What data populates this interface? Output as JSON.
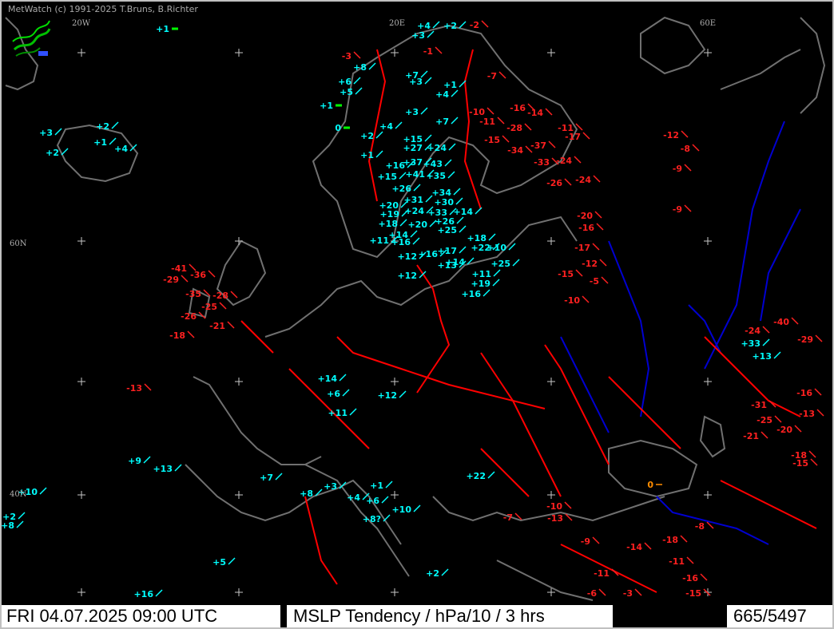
{
  "app": {
    "credit": "MetWatch  (c) 1991-2025 T.Bruns, B.Richter"
  },
  "map": {
    "meridian_labels": [
      "20W",
      "20E",
      "60E"
    ],
    "parallel_labels": [
      "60N",
      "40N"
    ],
    "colors": {
      "background": "#000000",
      "coast": "#707070",
      "borders": "#ff0000",
      "rivers": "#0000d0",
      "rising": "#00ffff",
      "falling": "#ff2020",
      "steady": "#00ff00",
      "zero": "#ff8c00"
    },
    "observations": [
      {
        "v": "+1",
        "t": "s"
      },
      {
        "v": "+4",
        "t": "r"
      },
      {
        "v": "+2",
        "t": "r"
      },
      {
        "v": "+3",
        "t": "r"
      },
      {
        "v": "+6",
        "t": "r"
      },
      {
        "v": "+8",
        "t": "r"
      },
      {
        "v": "+5",
        "t": "r"
      },
      {
        "v": "+7",
        "t": "r"
      },
      {
        "v": "+3",
        "t": "r"
      },
      {
        "v": "+1",
        "t": "r"
      },
      {
        "v": "+4",
        "t": "r"
      },
      {
        "v": "+1",
        "t": "s"
      },
      {
        "v": "+3",
        "t": "r"
      },
      {
        "v": "+7",
        "t": "r"
      },
      {
        "v": "0",
        "t": "s"
      },
      {
        "v": "+2",
        "t": "r"
      },
      {
        "v": "+4",
        "t": "r"
      },
      {
        "v": "+1",
        "t": "r"
      },
      {
        "v": "+15",
        "t": "r"
      },
      {
        "v": "+27",
        "t": "r"
      },
      {
        "v": "+24",
        "t": "r"
      },
      {
        "v": "+16",
        "t": "r"
      },
      {
        "v": "+37",
        "t": "r"
      },
      {
        "v": "+43",
        "t": "r"
      },
      {
        "v": "+15",
        "t": "r"
      },
      {
        "v": "+41",
        "t": "r"
      },
      {
        "v": "+35",
        "t": "r"
      },
      {
        "v": "+26",
        "t": "r"
      },
      {
        "v": "+31",
        "t": "r"
      },
      {
        "v": "+34",
        "t": "r"
      },
      {
        "v": "+20",
        "t": "r"
      },
      {
        "v": "+24",
        "t": "r"
      },
      {
        "v": "+30",
        "t": "r"
      },
      {
        "v": "+19",
        "t": "r"
      },
      {
        "v": "+33",
        "t": "r"
      },
      {
        "v": "+14",
        "t": "r"
      },
      {
        "v": "+18",
        "t": "r"
      },
      {
        "v": "+26",
        "t": "r"
      },
      {
        "v": "+20",
        "t": "r"
      },
      {
        "v": "+25",
        "t": "r"
      },
      {
        "v": "+14",
        "t": "r"
      },
      {
        "v": "+18",
        "t": "r"
      },
      {
        "v": "+11",
        "t": "r"
      },
      {
        "v": "+16",
        "t": "r"
      },
      {
        "v": "+17",
        "t": "r"
      },
      {
        "v": "+22",
        "t": "r"
      },
      {
        "v": "+10",
        "t": "r"
      },
      {
        "v": "+12",
        "t": "r"
      },
      {
        "v": "+16",
        "t": "r"
      },
      {
        "v": "+13",
        "t": "r"
      },
      {
        "v": "+25",
        "t": "r"
      },
      {
        "v": "+12",
        "t": "r"
      },
      {
        "v": "+14",
        "t": "r"
      },
      {
        "v": "+19",
        "t": "r"
      },
      {
        "v": "+11",
        "t": "r"
      },
      {
        "v": "+16",
        "t": "r"
      },
      {
        "v": "+3",
        "t": "r"
      },
      {
        "v": "+2",
        "t": "r"
      },
      {
        "v": "+1",
        "t": "r"
      },
      {
        "v": "+2",
        "t": "r"
      },
      {
        "v": "+4",
        "t": "r"
      },
      {
        "v": "-3",
        "t": "f"
      },
      {
        "v": "-2",
        "t": "f"
      },
      {
        "v": "-1",
        "t": "f"
      },
      {
        "v": "-7",
        "t": "f"
      },
      {
        "v": "-16",
        "t": "f"
      },
      {
        "v": "-14",
        "t": "f"
      },
      {
        "v": "-28",
        "t": "f"
      },
      {
        "v": "-15",
        "t": "f"
      },
      {
        "v": "-34",
        "t": "f"
      },
      {
        "v": "-37",
        "t": "f"
      },
      {
        "v": "-33",
        "t": "f"
      },
      {
        "v": "-24",
        "t": "f"
      },
      {
        "v": "-11",
        "t": "f"
      },
      {
        "v": "-17",
        "t": "f"
      },
      {
        "v": "-10",
        "t": "f"
      },
      {
        "v": "-11",
        "t": "f"
      },
      {
        "v": "-12",
        "t": "f"
      },
      {
        "v": "-8",
        "t": "f"
      },
      {
        "v": "-9",
        "t": "f"
      },
      {
        "v": "-26",
        "t": "f"
      },
      {
        "v": "-24",
        "t": "f"
      },
      {
        "v": "-20",
        "t": "f"
      },
      {
        "v": "-16",
        "t": "f"
      },
      {
        "v": "-17",
        "t": "f"
      },
      {
        "v": "-15",
        "t": "f"
      },
      {
        "v": "-10",
        "t": "f"
      },
      {
        "v": "-12",
        "t": "f"
      },
      {
        "v": "-5",
        "t": "f"
      },
      {
        "v": "-9",
        "t": "f"
      },
      {
        "v": "-40",
        "t": "f"
      },
      {
        "v": "-24",
        "t": "f"
      },
      {
        "v": "-29",
        "t": "f"
      },
      {
        "v": "+33",
        "t": "r"
      },
      {
        "v": "+13",
        "t": "r"
      },
      {
        "v": "-31",
        "t": "f"
      },
      {
        "v": "-25",
        "t": "f"
      },
      {
        "v": "-21",
        "t": "f"
      },
      {
        "v": "-20",
        "t": "f"
      },
      {
        "v": "-18",
        "t": "f"
      },
      {
        "v": "-15",
        "t": "f"
      },
      {
        "v": "-16",
        "t": "f"
      },
      {
        "v": "-13",
        "t": "f"
      },
      {
        "v": "-28",
        "t": "f"
      },
      {
        "v": "-36",
        "t": "f"
      },
      {
        "v": "-41",
        "t": "f"
      },
      {
        "v": "-29",
        "t": "f"
      },
      {
        "v": "-35",
        "t": "f"
      },
      {
        "v": "-25",
        "t": "f"
      },
      {
        "v": "-26",
        "t": "f"
      },
      {
        "v": "-21",
        "t": "f"
      },
      {
        "v": "-18",
        "t": "f"
      },
      {
        "v": "-13",
        "t": "f"
      },
      {
        "v": "+9",
        "t": "r"
      },
      {
        "v": "+13",
        "t": "r"
      },
      {
        "v": "+10",
        "t": "r"
      },
      {
        "v": "+2",
        "t": "r"
      },
      {
        "v": "+8",
        "t": "r"
      },
      {
        "v": "+6",
        "t": "r"
      },
      {
        "v": "+11",
        "t": "r"
      },
      {
        "v": "+12",
        "t": "r"
      },
      {
        "v": "+14",
        "t": "r"
      },
      {
        "v": "+22",
        "t": "r"
      },
      {
        "v": "-10",
        "t": "f"
      },
      {
        "v": "-13",
        "t": "f"
      },
      {
        "v": "-14",
        "t": "f"
      },
      {
        "v": "-18",
        "t": "f"
      },
      {
        "v": "-11",
        "t": "f"
      },
      {
        "v": "-16",
        "t": "f"
      },
      {
        "v": "-15",
        "t": "f"
      },
      {
        "v": "-6",
        "t": "f"
      },
      {
        "v": "-8",
        "t": "f"
      },
      {
        "v": "+8?",
        "t": "r"
      },
      {
        "v": "+16",
        "t": "r"
      },
      {
        "v": "+5",
        "t": "r"
      },
      {
        "v": "0",
        "t": "z"
      },
      {
        "v": "+1",
        "t": "r"
      },
      {
        "v": "+3",
        "t": "r"
      },
      {
        "v": "+7",
        "t": "r"
      },
      {
        "v": "+8",
        "t": "r"
      },
      {
        "v": "+4",
        "t": "r"
      },
      {
        "v": "+6",
        "t": "r"
      },
      {
        "v": "+10",
        "t": "r"
      },
      {
        "v": "+2",
        "t": "r"
      },
      {
        "v": "-9",
        "t": "f"
      },
      {
        "v": "-7",
        "t": "f"
      },
      {
        "v": "-11",
        "t": "f"
      },
      {
        "v": "-3",
        "t": "f"
      }
    ]
  },
  "statusbar": {
    "datetime": "FRI 04.07.2025 09:00 UTC",
    "product": "MSLP Tendency / hPa/10 / 3 hrs",
    "count": "665/5497"
  }
}
